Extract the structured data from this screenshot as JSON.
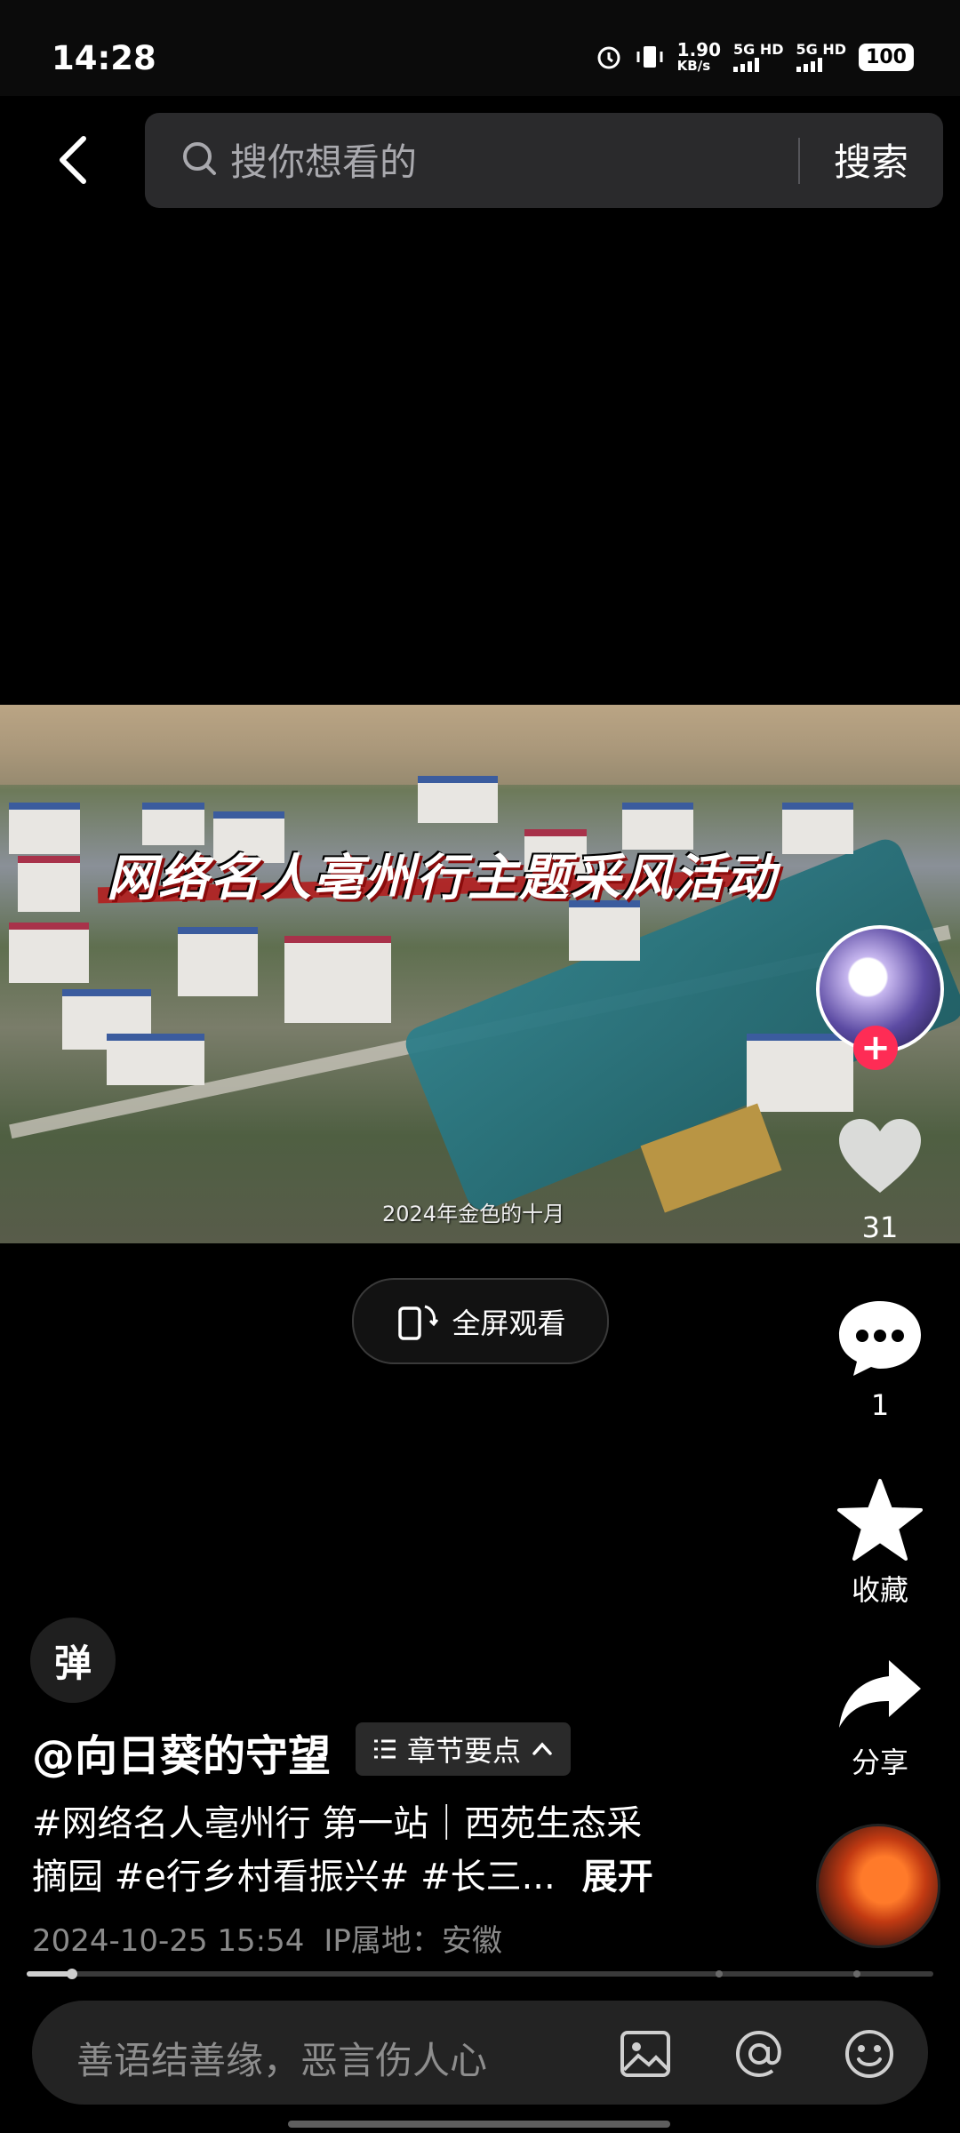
{
  "status_bar": {
    "time": "14:28",
    "net_speed_value": "1.90",
    "net_speed_unit": "KB/s",
    "sim1": "5G HD",
    "sim2": "5G HD",
    "battery": "100"
  },
  "search": {
    "placeholder": "搜你想看的",
    "button": "搜索"
  },
  "video": {
    "overlay_title": "网络名人亳州行主题采风活动",
    "subtitle": "2024年金色的十月"
  },
  "rail": {
    "like_count": "31",
    "comment_count": "1",
    "favorite_label": "收藏",
    "share_label": "分享",
    "follow_symbol": "+"
  },
  "fullscreen": {
    "label": "全屏观看"
  },
  "post": {
    "danmu_label": "弹",
    "author": "@向日葵的守望",
    "chapter_label": "章节要点",
    "desc_line1": "#网络名人亳州行 第一站｜西苑生态采",
    "desc_line2": "摘园 #e行乡村看振兴# #长三...",
    "expand_label": "展开",
    "datetime": "2024-10-25 15:54",
    "ip_location": "IP属地：安徽",
    "progress": 0.05
  },
  "comment_input": {
    "placeholder": "善语结善缘，恶言伤人心"
  },
  "colors": {
    "accent": "#fe2c55",
    "search_bg": "#2a2a2c"
  }
}
